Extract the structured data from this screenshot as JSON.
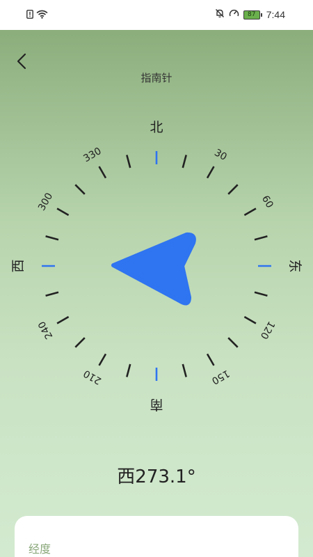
{
  "status_bar": {
    "battery_level": "87",
    "time": "7:44",
    "icons": [
      "sim-alert-icon",
      "wifi-icon",
      "bell-off-icon",
      "speed-icon",
      "battery-icon"
    ]
  },
  "header": {
    "back_icon": "chevron-left-icon",
    "title": "指南针"
  },
  "compass": {
    "cardinals": {
      "north": "北",
      "east": "东",
      "south": "南",
      "west": "西"
    },
    "degree_labels": [
      "30",
      "60",
      "120",
      "150",
      "210",
      "240",
      "300",
      "330"
    ],
    "heading_value": "西273.1°",
    "heading_degrees": 273.1,
    "accent_color": "#2f74f0",
    "tick_color": "#222222"
  },
  "info_card": {
    "longitude_label": "经度"
  }
}
